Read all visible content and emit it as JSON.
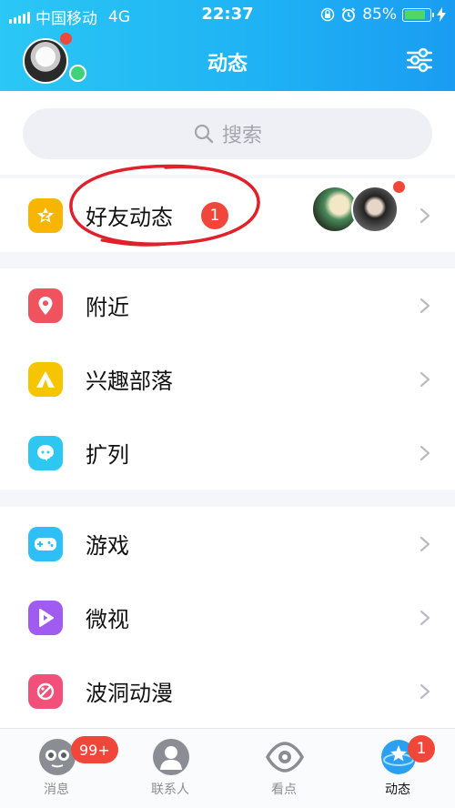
{
  "status_bar": {
    "carrier": "中国移动",
    "network": "4G",
    "time": "22:37",
    "battery": "85%",
    "battery_level": 0.85
  },
  "header": {
    "title": "动态",
    "avatar_icon": "user-avatar",
    "settings_icon": "sliders-icon"
  },
  "search": {
    "placeholder": "搜索",
    "icon": "search-icon"
  },
  "sections": [
    {
      "items": [
        {
          "label": "好友动态",
          "icon": "friends-feed-icon",
          "badge": "1",
          "color": "#f7b500"
        }
      ]
    },
    {
      "items": [
        {
          "label": "附近",
          "icon": "location-pin-icon",
          "color": "#f0525e"
        },
        {
          "label": "兴趣部落",
          "icon": "tent-icon",
          "color": "#f7c400"
        },
        {
          "label": "扩列",
          "icon": "chat-plus-icon",
          "color": "#2dc7f2"
        }
      ]
    },
    {
      "items": [
        {
          "label": "游戏",
          "icon": "gamepad-icon",
          "color": "#2dbff5"
        },
        {
          "label": "微视",
          "icon": "play-icon",
          "color": "#a05cf0"
        },
        {
          "label": "波洞动漫",
          "icon": "comic-icon",
          "color": "#f0507a"
        }
      ]
    }
  ],
  "tabbar": {
    "tabs": [
      {
        "label": "消息",
        "icon": "messages-icon",
        "badge": "99+"
      },
      {
        "label": "联系人",
        "icon": "contacts-icon"
      },
      {
        "label": "看点",
        "icon": "eye-icon"
      },
      {
        "label": "动态",
        "icon": "star-globe-icon",
        "badge": "1",
        "active": true
      }
    ]
  },
  "colors": {
    "header_gradient_start": "#2bc7f5",
    "header_gradient_end": "#1a9cf2",
    "badge_red": "#f0473a",
    "annotation_red": "#e0202a"
  }
}
